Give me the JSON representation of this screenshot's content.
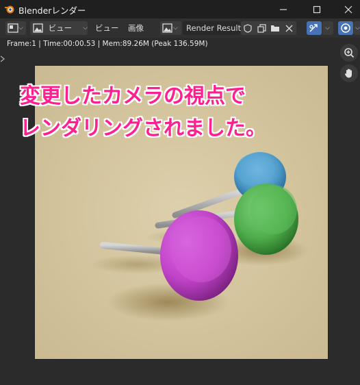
{
  "window": {
    "title": "Blenderレンダー"
  },
  "toolbar": {
    "view_dropdown_label": "ビュー",
    "view_menu": "ビュー",
    "image_menu": "画像",
    "image_name": "Render Result"
  },
  "info": {
    "text": "Frame:1 | Time:00:00.53 | Mem:89.26M (Peak 136.59M)"
  },
  "overlay": {
    "line1": "変更したカメラの視点で",
    "line2": "レンダリングされました。"
  },
  "colors": {
    "caption": "#ff1f8e",
    "render_background": "#d5c59f",
    "accent_blue": "#4772b3"
  }
}
